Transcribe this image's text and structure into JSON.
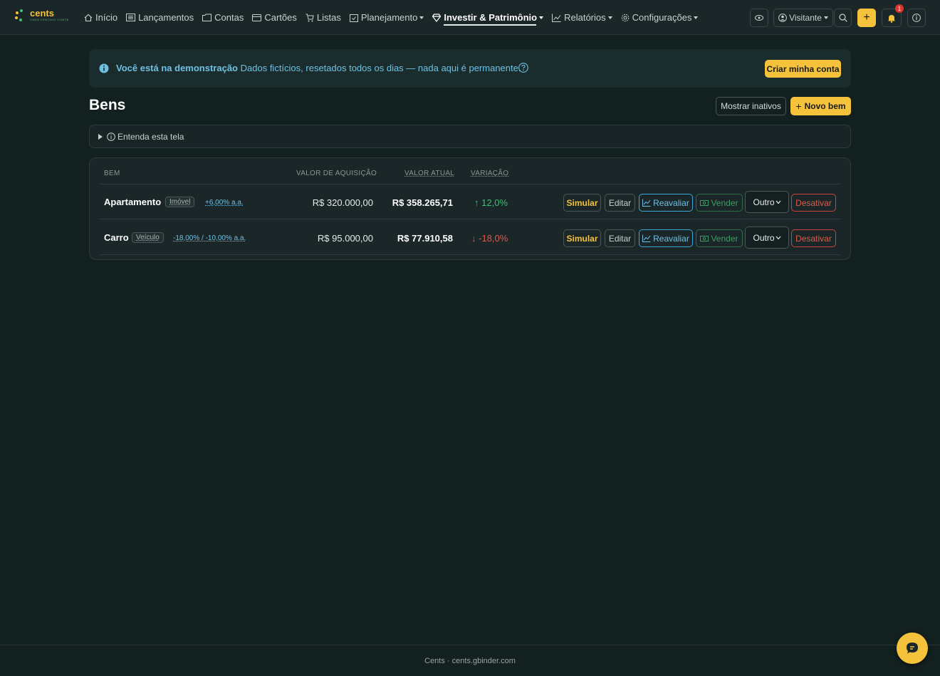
{
  "brand": {
    "name": "cents",
    "tagline": "CADA CENTAVO CONTA"
  },
  "nav": {
    "items": [
      {
        "label": "Início"
      },
      {
        "label": "Lançamentos"
      },
      {
        "label": "Contas"
      },
      {
        "label": "Cartões"
      },
      {
        "label": "Listas"
      },
      {
        "label": "Planejamento"
      },
      {
        "label": "Investir & Patrimônio"
      },
      {
        "label": "Relatórios"
      },
      {
        "label": "Configurações"
      }
    ],
    "visitor_label": "Visitante",
    "notifications_count": "1",
    "plus_label": "+"
  },
  "banner": {
    "title": "Você está na demonstração",
    "text": "Dados fictícios, resetados todos os dias — nada aqui é permanente.",
    "create_label": "Criar minha conta"
  },
  "page": {
    "title": "Bens",
    "show_inactive_label": "Mostrar inativos",
    "new_label": "Novo bem",
    "help_label": "Entenda esta tela"
  },
  "table": {
    "headers": {
      "asset": "BEM",
      "acquisition": "VALOR DE AQUISIÇÃO",
      "current": "VALOR ATUAL",
      "variation": "VARIAÇÃO"
    },
    "rows": [
      {
        "name": "Apartamento",
        "type": "Imóvel",
        "rate": "+6,00% a.a.",
        "acquisition": "R$ 320.000,00",
        "current": "R$ 358.265,71",
        "variation": "12,0%",
        "direction": "up"
      },
      {
        "name": "Carro",
        "type": "Veículo",
        "rate": "-18,00% / -10,00% a.a.",
        "acquisition": "R$ 95.000,00",
        "current": "R$ 77.910,58",
        "variation": "-18,0%",
        "direction": "down"
      }
    ],
    "actions": {
      "simulate": "Simular",
      "edit": "Editar",
      "revalue": "Reavaliar",
      "sell": "Vender",
      "other": "Outro",
      "deactivate": "Desativar"
    }
  },
  "footer": {
    "text": "Cents · cents.gbinder.com"
  },
  "colors": {
    "background": "#12201f",
    "accent": "#f5c33b",
    "info": "#6ec1e4",
    "positive": "#3ec07a",
    "negative": "#e05a4a"
  }
}
